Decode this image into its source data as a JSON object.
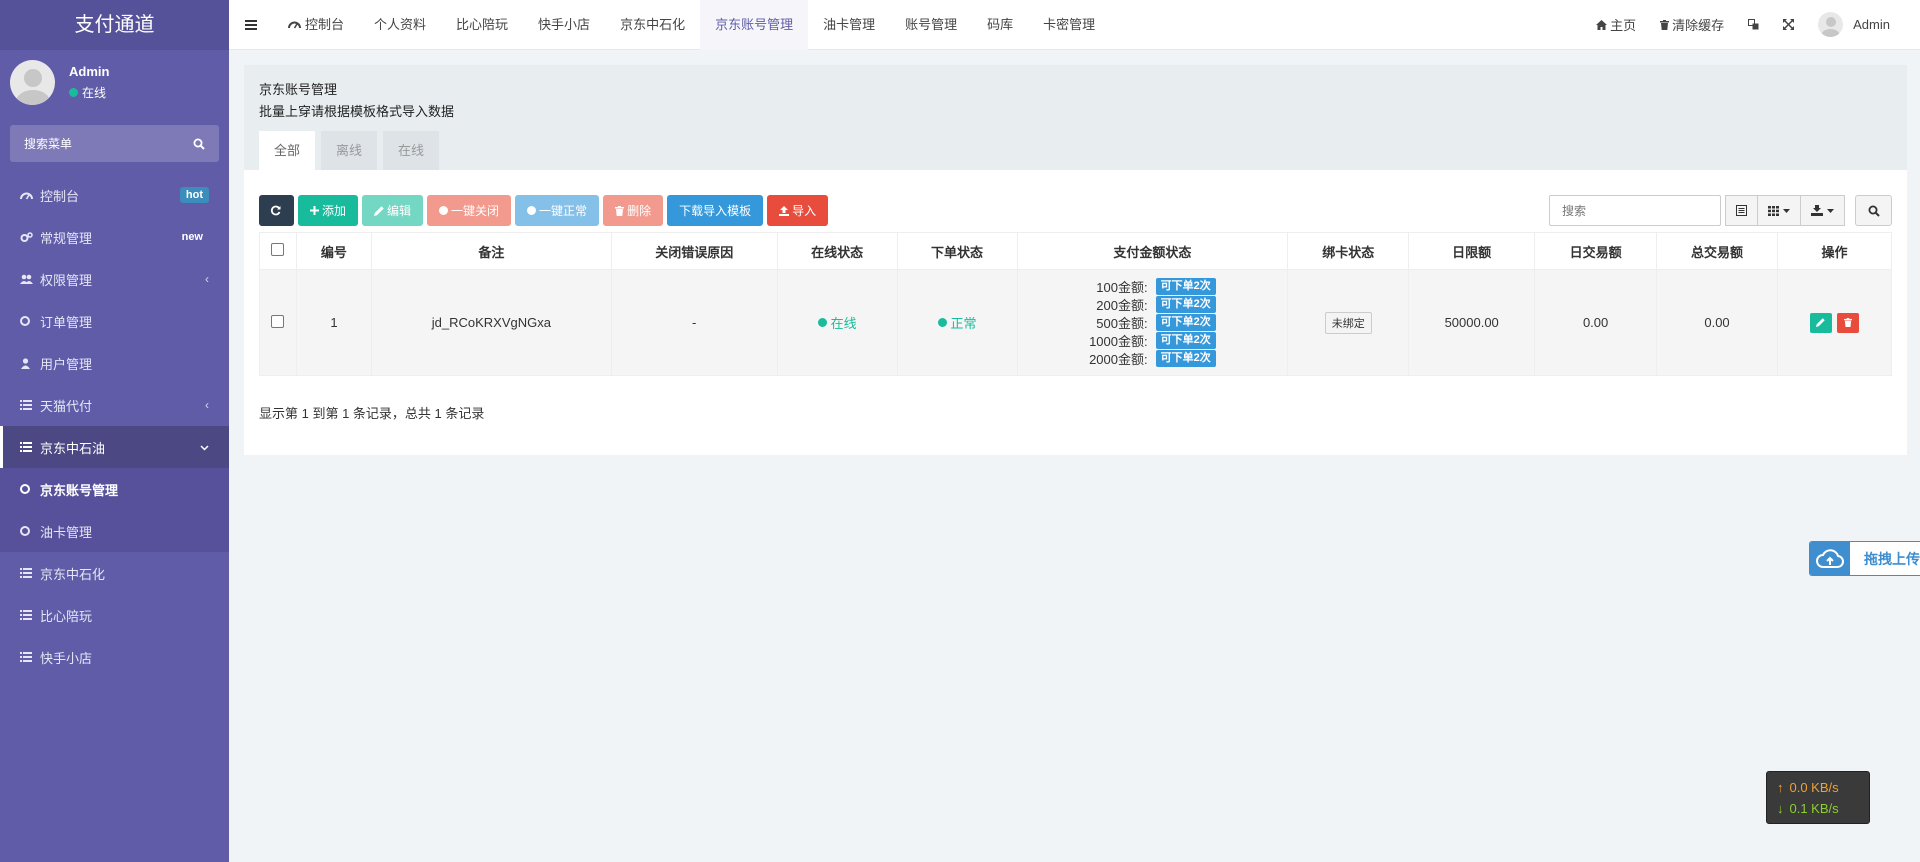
{
  "app": {
    "title": "支付通道"
  },
  "user": {
    "name": "Admin",
    "status": "在线"
  },
  "sidebar": {
    "search_label": "搜索菜单",
    "items": [
      {
        "label": "控制台",
        "badge": "hot"
      },
      {
        "label": "常规管理",
        "badge": "new"
      },
      {
        "label": "权限管理"
      },
      {
        "label": "订单管理"
      },
      {
        "label": "用户管理"
      },
      {
        "label": "天猫代付"
      },
      {
        "label": "京东中石油"
      },
      {
        "label": "京东账号管理"
      },
      {
        "label": "油卡管理"
      },
      {
        "label": "京东中石化"
      },
      {
        "label": "比心陪玩"
      },
      {
        "label": "快手小店"
      }
    ]
  },
  "topnav": {
    "tabs": [
      "控制台",
      "个人资料",
      "比心陪玩",
      "快手小店",
      "京东中石化",
      "京东账号管理",
      "油卡管理",
      "账号管理",
      "码库",
      "卡密管理"
    ],
    "right": {
      "home": "主页",
      "clear_cache": "清除缓存",
      "user": "Admin"
    }
  },
  "panel": {
    "title": "京东账号管理",
    "subtitle": "批量上穿请根据模板格式导入数据",
    "tabs": [
      "全部",
      "离线",
      "在线"
    ]
  },
  "toolbar": {
    "add": "添加",
    "edit": "编辑",
    "close_all": "一键关闭",
    "normal_all": "一键正常",
    "delete": "删除",
    "download_template": "下载导入模板",
    "import": "导入",
    "search_placeholder": "搜索"
  },
  "table": {
    "headers": [
      "编号",
      "备注",
      "关闭错误原因",
      "在线状态",
      "下单状态",
      "支付金额状态",
      "绑卡状态",
      "日限额",
      "日交易额",
      "总交易额",
      "操作"
    ],
    "rows": [
      {
        "id": "1",
        "remark": "jd_RCoKRXVgNGxa",
        "close_reason": "-",
        "online": "在线",
        "order_status": "正常",
        "amounts": [
          {
            "label": "100金额:",
            "badge": "可下单2次"
          },
          {
            "label": "200金额:",
            "badge": "可下单2次"
          },
          {
            "label": "500金额:",
            "badge": "可下单2次"
          },
          {
            "label": "1000金额:",
            "badge": "可下单2次"
          },
          {
            "label": "2000金额:",
            "badge": "可下单2次"
          }
        ],
        "bind": "未绑定",
        "daily_limit": "50000.00",
        "daily_amount": "0.00",
        "total_amount": "0.00"
      }
    ],
    "footer": "显示第 1 到第 1 条记录，总共 1 条记录"
  },
  "widgets": {
    "upload": "拖拽上传",
    "speed_up": "0.0 KB/s",
    "speed_down": "0.1 KB/s"
  }
}
